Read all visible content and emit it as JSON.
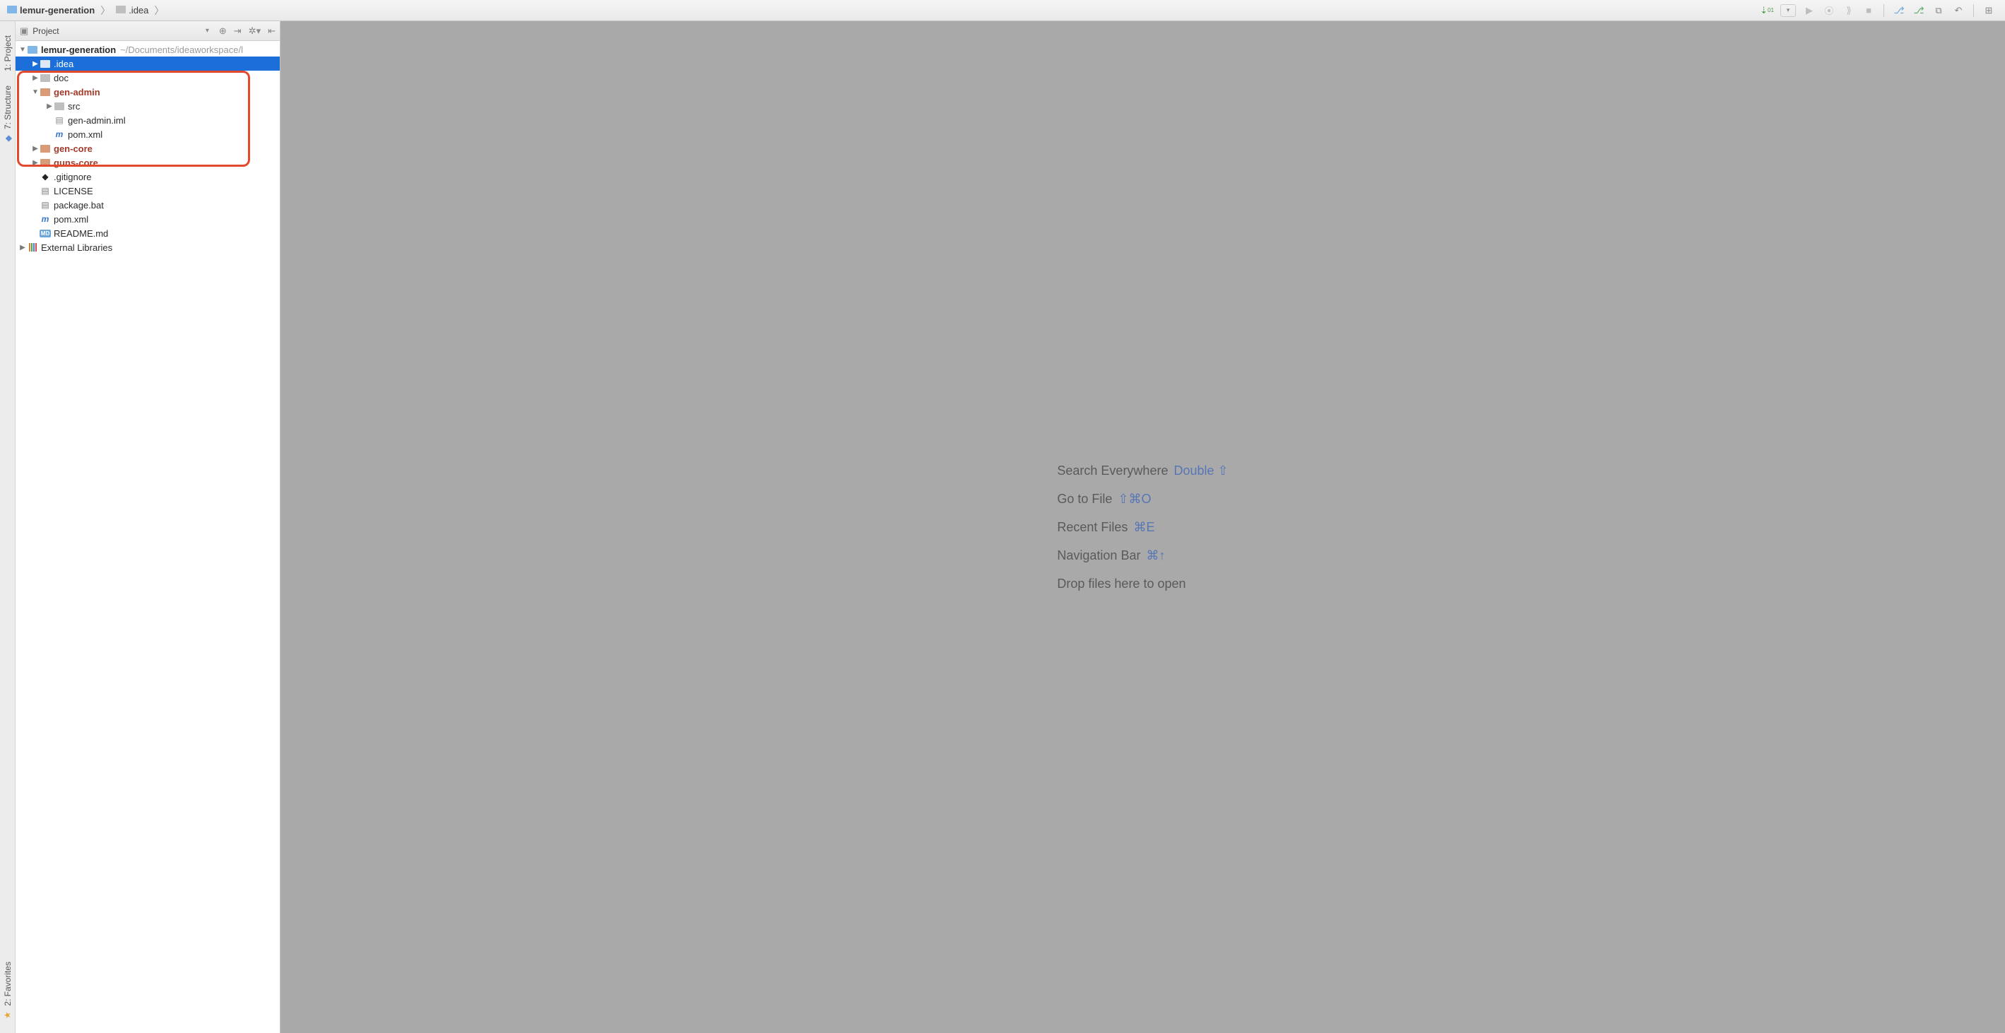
{
  "breadcrumb": {
    "root": "lemur-generation",
    "sub": ".idea"
  },
  "toolwindows": {
    "project": "1: Project",
    "structure": "7: Structure",
    "favorites": "2: Favorites"
  },
  "projectPanel": {
    "title": "Project"
  },
  "tree": {
    "rootName": "lemur-generation",
    "rootHint": "~/Documents/ideaworkspace/l",
    "idea": ".idea",
    "doc": "doc",
    "genAdmin": "gen-admin",
    "src": "src",
    "genAdminIml": "gen-admin.iml",
    "pomXml": "pom.xml",
    "genCore": "gen-core",
    "gunsCore": "guns-core",
    "gitignore": ".gitignore",
    "license": "LICENSE",
    "packageBat": "package.bat",
    "pomXmlRoot": "pom.xml",
    "readme": "README.md",
    "externalLibs": "External Libraries"
  },
  "welcome": {
    "searchEverywhere": "Search Everywhere",
    "searchEverywhereKey": "Double ⇧",
    "goToFile": "Go to File",
    "goToFileKey": "⇧⌘O",
    "recentFiles": "Recent Files",
    "recentFilesKey": "⌘E",
    "navBar": "Navigation Bar",
    "navBarKey": "⌘↑",
    "dropFiles": "Drop files here to open"
  }
}
